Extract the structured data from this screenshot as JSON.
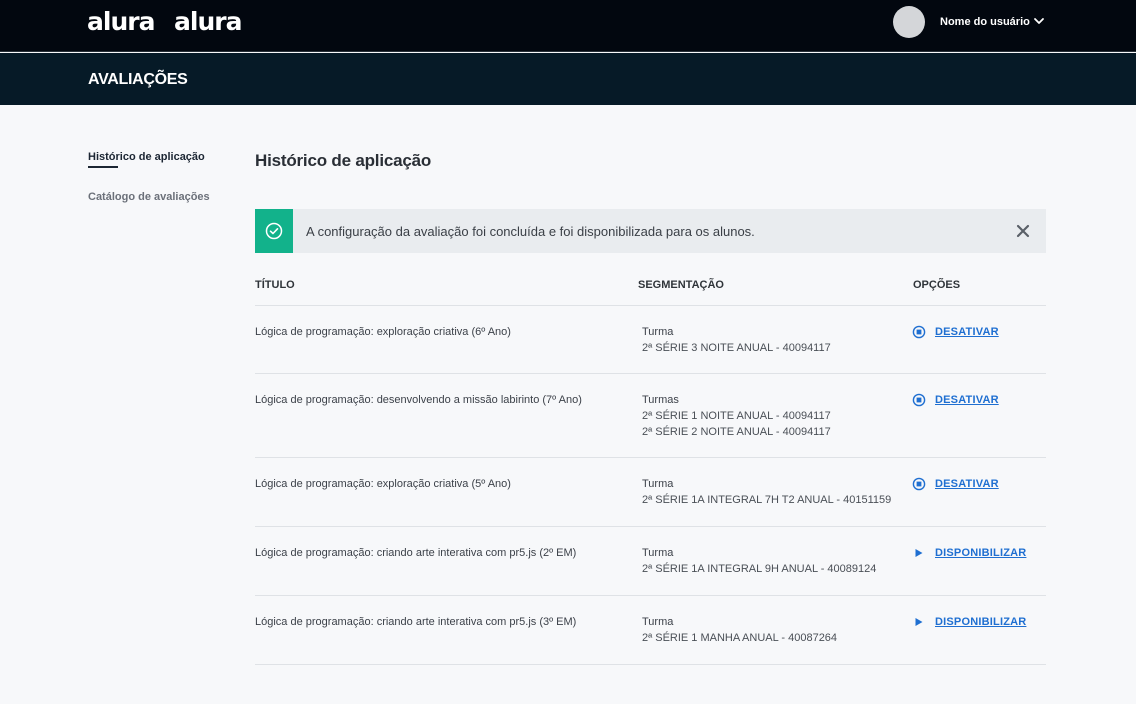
{
  "topbar": {
    "logo_primary": "alura",
    "logo_secondary": "alura",
    "username": "Nome do usuário"
  },
  "header": {
    "title": "AVALIAÇÕES"
  },
  "sidebar": {
    "items": [
      {
        "label": "Histórico de aplicação",
        "active": true
      },
      {
        "label": "Catálogo de avaliações",
        "active": false
      }
    ]
  },
  "main": {
    "title": "Histórico de aplicação",
    "alert": {
      "message": "A configuração da avaliação foi concluída e foi disponibilizada para os alunos."
    },
    "table": {
      "headers": {
        "title": "TÍTULO",
        "segmentation": "SEGMENTAÇÃO",
        "options": "OPÇÕES"
      },
      "rows": [
        {
          "title": "Lógica de programação: exploração criativa (6º Ano)",
          "segment_label": "Turma",
          "segments": [
            "2ª SÉRIE 3 NOITE ANUAL - 40094117"
          ],
          "action": "DESATIVAR",
          "action_icon": "stop-circle-icon"
        },
        {
          "title": "Lógica de programação: desenvolvendo a missão labirinto (7º Ano)",
          "segment_label": "Turmas",
          "segments": [
            "2ª SÉRIE 1 NOITE ANUAL - 40094117",
            "2ª SÉRIE 2 NOITE ANUAL - 40094117"
          ],
          "action": "DESATIVAR",
          "action_icon": "stop-circle-icon"
        },
        {
          "title": "Lógica de programação: exploração criativa (5º Ano)",
          "segment_label": "Turma",
          "segments": [
            "2ª SÉRIE 1A INTEGRAL 7H T2 ANUAL - 40151159"
          ],
          "action": "DESATIVAR",
          "action_icon": "stop-circle-icon"
        },
        {
          "title": "Lógica de programação: criando arte interativa com pr5.js (2º EM)",
          "segment_label": "Turma",
          "segments": [
            "2ª SÉRIE 1A INTEGRAL 9H ANUAL - 40089124"
          ],
          "action": "DISPONIBILIZAR",
          "action_icon": "play-icon"
        },
        {
          "title": "Lógica de programação: criando arte interativa com pr5.js (3º EM)",
          "segment_label": "Turma",
          "segments": [
            "2ª SÉRIE 1 MANHA ANUAL - 40087264"
          ],
          "action": "DISPONIBILIZAR",
          "action_icon": "play-icon"
        }
      ]
    }
  },
  "colors": {
    "topbar": "#02070f",
    "titlebar": "#061a27",
    "success": "#12b28b",
    "link": "#1f6fd1"
  }
}
